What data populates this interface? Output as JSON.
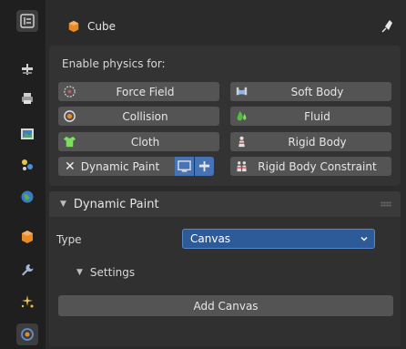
{
  "header": {
    "object_name": "Cube"
  },
  "physics": {
    "title": "Enable physics for:",
    "buttons": {
      "force_field": "Force Field",
      "soft_body": "Soft Body",
      "collision": "Collision",
      "fluid": "Fluid",
      "cloth": "Cloth",
      "rigid_body": "Rigid Body",
      "dynamic_paint": "Dynamic Paint",
      "rigid_body_constraint": "Rigid Body Constraint"
    }
  },
  "dynamic_paint": {
    "title": "Dynamic Paint",
    "type_label": "Type",
    "type_value": "Canvas",
    "settings_label": "Settings",
    "add_button": "Add Canvas"
  },
  "colors": {
    "accent": "#4772b3",
    "dropdown_bg": "#2d5a99",
    "panel_bg": "#333333",
    "button_bg": "#545454"
  },
  "tabs": [
    {
      "name": "tool-tab",
      "icon": "tool-icon",
      "active": true
    },
    {
      "name": "render-tab",
      "icon": "render-icon"
    },
    {
      "name": "output-tab",
      "icon": "printer-icon"
    },
    {
      "name": "view-layer-tab",
      "icon": "image-icon"
    },
    {
      "name": "scene-tab",
      "icon": "scene-icon"
    },
    {
      "name": "world-tab",
      "icon": "world-icon"
    },
    {
      "name": "object-tab",
      "icon": "object-icon"
    },
    {
      "name": "modifiers-tab",
      "icon": "wrench-icon"
    },
    {
      "name": "particles-tab",
      "icon": "particles-icon"
    },
    {
      "name": "physics-tab",
      "icon": "physics-icon",
      "active": true
    }
  ]
}
